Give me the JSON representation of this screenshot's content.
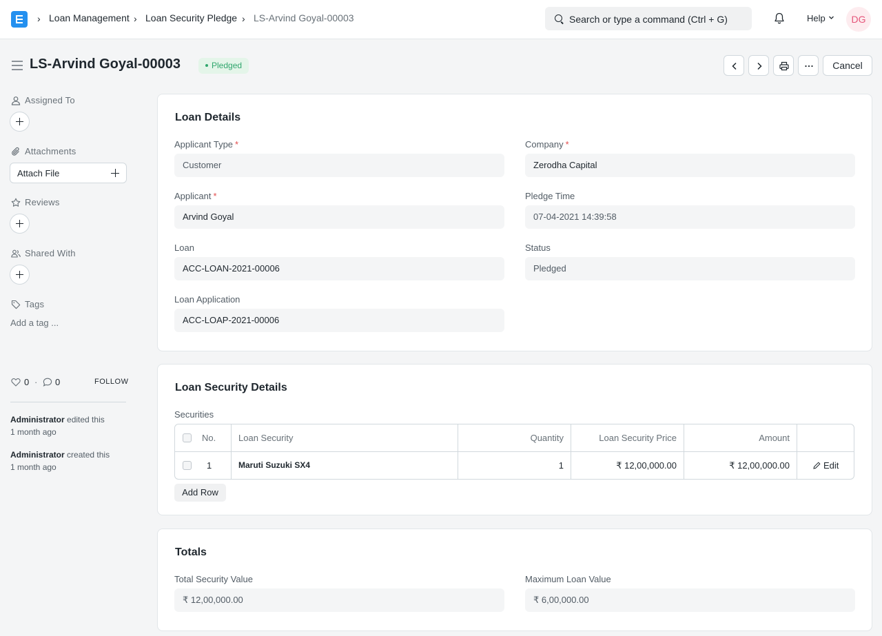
{
  "navbar": {
    "breadcrumbs": [
      "Loan Management",
      "Loan Security Pledge",
      "LS-Arvind Goyal-00003"
    ],
    "search_placeholder": "Search or type a command (Ctrl + G)",
    "help_label": "Help",
    "avatar_initials": "DG"
  },
  "page": {
    "title": "LS-Arvind Goyal-00003",
    "status_badge": "Pledged",
    "cancel_label": "Cancel"
  },
  "sidebar": {
    "assigned_to": "Assigned To",
    "attachments": "Attachments",
    "attach_file": "Attach File",
    "reviews": "Reviews",
    "shared_with": "Shared With",
    "tags": "Tags",
    "add_tag": "Add a tag ...",
    "likes": "0",
    "comments": "0",
    "follow": "FOLLOW",
    "activity": [
      {
        "user": "Administrator",
        "action": "edited this",
        "time": "1 month ago"
      },
      {
        "user": "Administrator",
        "action": "created this",
        "time": "1 month ago"
      }
    ]
  },
  "loan_details": {
    "title": "Loan Details",
    "applicant_type_label": "Applicant Type",
    "applicant_type": "Customer",
    "company_label": "Company",
    "company": "Zerodha Capital",
    "applicant_label": "Applicant",
    "applicant": "Arvind Goyal",
    "pledge_time_label": "Pledge Time",
    "pledge_time": "07-04-2021 14:39:58",
    "loan_label": "Loan",
    "loan": "ACC-LOAN-2021-00006",
    "status_label": "Status",
    "status": "Pledged",
    "loan_application_label": "Loan Application",
    "loan_application": "ACC-LOAP-2021-00006"
  },
  "security_details": {
    "title": "Loan Security Details",
    "table_label": "Securities",
    "columns": [
      "No.",
      "Loan Security",
      "Quantity",
      "Loan Security Price",
      "Amount"
    ],
    "rows": [
      {
        "no": "1",
        "security": "Maruti Suzuki SX4",
        "quantity": "1",
        "price": "₹ 12,00,000.00",
        "amount": "₹ 12,00,000.00",
        "edit": "Edit"
      }
    ],
    "add_row": "Add Row"
  },
  "totals": {
    "title": "Totals",
    "total_security_label": "Total Security Value",
    "total_security": "₹ 12,00,000.00",
    "max_loan_label": "Maximum Loan Value",
    "max_loan": "₹ 6,00,000.00"
  }
}
